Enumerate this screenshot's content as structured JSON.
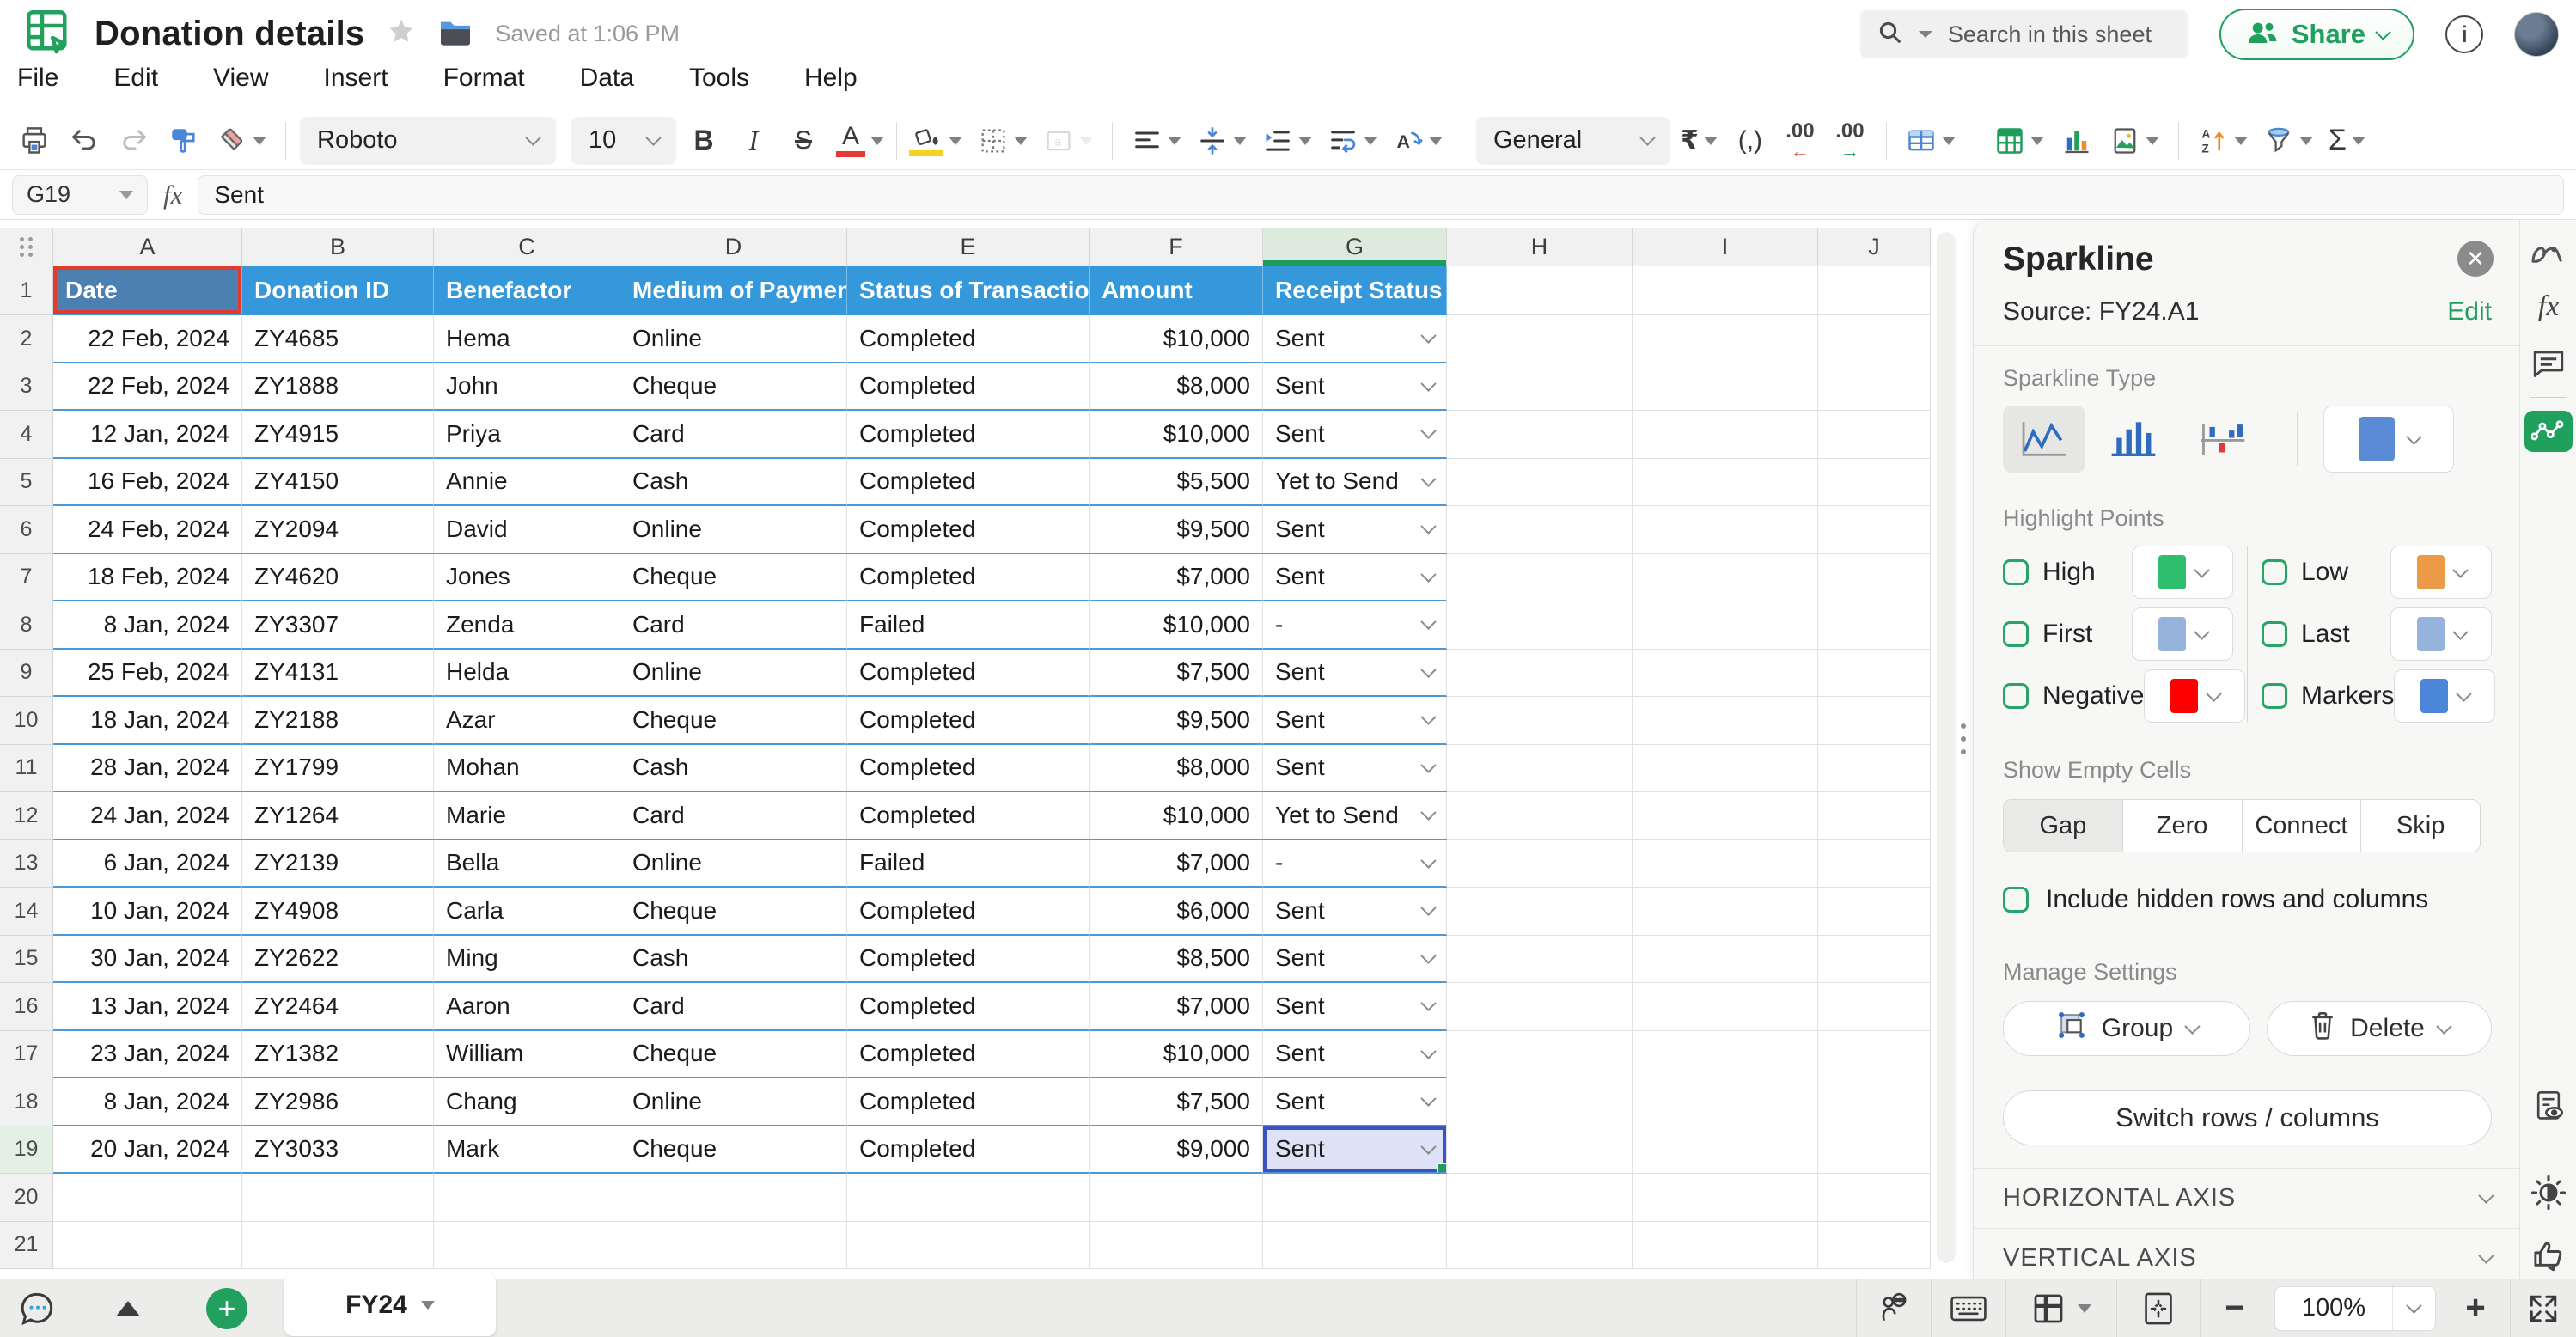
{
  "header": {
    "title": "Donation details",
    "saved_status": "Saved at 1:06 PM",
    "menus": [
      "File",
      "Edit",
      "View",
      "Insert",
      "Format",
      "Data",
      "Tools",
      "Help"
    ],
    "search_placeholder": "Search in this sheet",
    "share_label": "Share"
  },
  "toolbar": {
    "font_name": "Roboto",
    "font_size": "10",
    "number_format": "General",
    "currency_symbol": "₹",
    "comma_style": "(,)",
    "decimal": ".00",
    "sigma": "Σ"
  },
  "formula_bar": {
    "cell_ref": "G19",
    "fx_label": "fx",
    "value": "Sent"
  },
  "grid": {
    "col_letters": [
      "A",
      "B",
      "C",
      "D",
      "E",
      "F",
      "G",
      "H",
      "I",
      "J"
    ],
    "row_count": 21,
    "headers": [
      "Date",
      "Donation ID",
      "Benefactor",
      "Medium of Payment",
      "Status of Transaction",
      "Amount",
      "Receipt Status"
    ],
    "rows": [
      [
        "22 Feb, 2024",
        "ZY4685",
        "Hema",
        "Online",
        "Completed",
        "$10,000",
        "Sent"
      ],
      [
        "22 Feb, 2024",
        "ZY1888",
        "John",
        "Cheque",
        "Completed",
        "$8,000",
        "Sent"
      ],
      [
        "12 Jan, 2024",
        "ZY4915",
        "Priya",
        "Card",
        "Completed",
        "$10,000",
        "Sent"
      ],
      [
        "16 Feb, 2024",
        "ZY4150",
        "Annie",
        "Cash",
        "Completed",
        "$5,500",
        "Yet to Send"
      ],
      [
        "24 Feb, 2024",
        "ZY2094",
        "David",
        "Online",
        "Completed",
        "$9,500",
        "Sent"
      ],
      [
        "18 Feb, 2024",
        "ZY4620",
        "Jones",
        "Cheque",
        "Completed",
        "$7,000",
        "Sent"
      ],
      [
        "8 Jan, 2024",
        "ZY3307",
        "Zenda",
        "Card",
        "Failed",
        "$10,000",
        "-"
      ],
      [
        "25 Feb, 2024",
        "ZY4131",
        "Helda",
        "Online",
        "Completed",
        "$7,500",
        "Sent"
      ],
      [
        "18 Jan, 2024",
        "ZY2188",
        "Azar",
        "Cheque",
        "Completed",
        "$9,500",
        "Sent"
      ],
      [
        "28 Jan, 2024",
        "ZY1799",
        "Mohan",
        "Cash",
        "Completed",
        "$8,000",
        "Sent"
      ],
      [
        "24 Jan, 2024",
        "ZY1264",
        "Marie",
        "Card",
        "Completed",
        "$10,000",
        "Yet to Send"
      ],
      [
        "6 Jan, 2024",
        "ZY2139",
        "Bella",
        "Online",
        "Failed",
        "$7,000",
        "-"
      ],
      [
        "10 Jan, 2024",
        "ZY4908",
        "Carla",
        "Cheque",
        "Completed",
        "$6,000",
        "Sent"
      ],
      [
        "30 Jan, 2024",
        "ZY2622",
        "Ming",
        "Cash",
        "Completed",
        "$8,500",
        "Sent"
      ],
      [
        "13 Jan, 2024",
        "ZY2464",
        "Aaron",
        "Card",
        "Completed",
        "$7,000",
        "Sent"
      ],
      [
        "23 Jan, 2024",
        "ZY1382",
        "William",
        "Cheque",
        "Completed",
        "$10,000",
        "Sent"
      ],
      [
        "8 Jan, 2024",
        "ZY2986",
        "Chang",
        "Online",
        "Completed",
        "$7,500",
        "Sent"
      ],
      [
        "20 Jan, 2024",
        "ZY3033",
        "Mark",
        "Cheque",
        "Completed",
        "$9,000",
        "Sent"
      ]
    ],
    "selected_cell": "G19",
    "selected_value": "Sent",
    "colors": {
      "table_header_fill": "#3598db",
      "source_cell_fill": "#4c80b1",
      "source_cell_border": "#e23b2e",
      "selection_fill": "#dfe2f6",
      "selection_border": "#3a52c4",
      "selected_col_header": "#dcebdd",
      "selected_col_underline": "#1e9c59",
      "table_row_border": "#4a99d6"
    }
  },
  "panel": {
    "title": "Sparkline",
    "source_label": "Source: FY24.A1",
    "edit_label": "Edit",
    "type_label": "Sparkline Type",
    "type_options": [
      "line-sparkline",
      "column-sparkline",
      "winloss-sparkline"
    ],
    "type_selected": "line-sparkline",
    "sparkline_color": "#5b8bd5",
    "highlight_label": "Highlight Points",
    "highlight_left": [
      {
        "label": "High",
        "color": "#2FBE6E"
      },
      {
        "label": "First",
        "color": "#96B3DB"
      },
      {
        "label": "Negative",
        "color": "#FF0000"
      }
    ],
    "highlight_right": [
      {
        "label": "Low",
        "color": "#EB9A47"
      },
      {
        "label": "Last",
        "color": "#96B3DB"
      },
      {
        "label": "Markers",
        "color": "#4C86D8"
      }
    ],
    "empty_cells_label": "Show Empty Cells",
    "empty_cells_options": [
      "Gap",
      "Zero",
      "Connect",
      "Skip"
    ],
    "empty_cells_selected": "Gap",
    "include_hidden_label": "Include hidden rows and columns",
    "manage_label": "Manage Settings",
    "group_label": "Group",
    "delete_label": "Delete",
    "switch_label": "Switch rows / columns",
    "sections": [
      "HORIZONTAL AXIS",
      "VERTICAL AXIS"
    ],
    "accent_green": "#1FA15D"
  },
  "bottom_bar": {
    "sheet_tab": "FY24",
    "zoom_level": "100%"
  }
}
